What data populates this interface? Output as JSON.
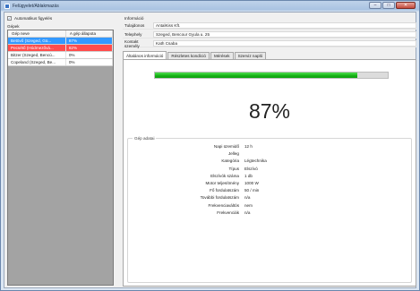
{
  "window": {
    "title": "Felügyelet/Ablakmazás",
    "controls": [
      "–",
      "□",
      "✕"
    ]
  },
  "left": {
    "auto_monitor_label": "Automatikus figyelés",
    "auto_monitor_checked": true,
    "machines_label": "Gépek",
    "columns": [
      "Gép neve",
      "A gép állapota"
    ],
    "rows": [
      {
        "name": "Betövő (Szeged, Gü...",
        "status": "87%",
        "state": "selected"
      },
      {
        "name": "Pecsétő (Hódmezővá...",
        "status": "82%",
        "state": "alert"
      },
      {
        "name": "Bitzer (Szeged, Bencú...",
        "status": "0%",
        "state": "normal"
      },
      {
        "name": "Copeland (Szeged, Be...",
        "status": "0%",
        "state": "normal"
      }
    ]
  },
  "info": {
    "title": "Információ",
    "fields": [
      {
        "label": "Tulajdonos",
        "value": "AntalKiss Kft."
      },
      {
        "label": "Telephely",
        "value": "Szeged, Bencour Gyula u. 25"
      },
      {
        "label": "Kontakt személy",
        "value": "Kath Csaba"
      }
    ]
  },
  "tabs": [
    "Általános információ",
    "Részletes kondíció",
    "Mérések",
    "Szerviz napló"
  ],
  "active_tab": 0,
  "progress": {
    "value": 0.87,
    "label": "87%"
  },
  "details": {
    "title": "Gép adatai",
    "fields": [
      {
        "label": "Napi üzemidő",
        "value": "12 h"
      },
      {
        "label": "Jelleg",
        "value": ""
      },
      {
        "label": "Kategória",
        "value": "Légtechnika"
      },
      {
        "label": "Típus",
        "value": "Elszívó"
      },
      {
        "label": "Elszívók száma",
        "value": "1 db"
      },
      {
        "label": "Motor teljesítmény",
        "value": "1000 W"
      },
      {
        "label": "Fő fordulatszám",
        "value": "50 / min"
      },
      {
        "label": "További fordulatszám",
        "value": "n/a"
      },
      {
        "label": "Frekvenciaváltós",
        "value": "nem"
      },
      {
        "label": "Frekvenciák",
        "value": "n/a"
      }
    ]
  }
}
